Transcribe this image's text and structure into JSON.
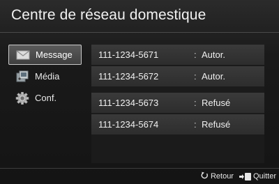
{
  "title": "Centre de réseau domestique",
  "menu": [
    {
      "label": "Message",
      "icon": "envelope-icon",
      "active": true
    },
    {
      "label": "Média",
      "icon": "media-icon",
      "active": false
    },
    {
      "label": "Conf.",
      "icon": "gear-icon",
      "active": false
    }
  ],
  "devices": [
    {
      "number": "111-1234-5671",
      "separator": ":",
      "status": "Autor."
    },
    {
      "number": "111-1234-5672",
      "separator": ":",
      "status": "Autor."
    },
    {
      "number": "111-1234-5673",
      "separator": ":",
      "status": "Refusé"
    },
    {
      "number": "111-1234-5674",
      "separator": ":",
      "status": "Refusé"
    }
  ],
  "footer": {
    "return_label": "Retour",
    "exit_label": "Quitter"
  },
  "colors": {
    "background": "#141414",
    "row": "#333333",
    "active_border": "#c9c9c9",
    "text": "#f0f0f0"
  }
}
